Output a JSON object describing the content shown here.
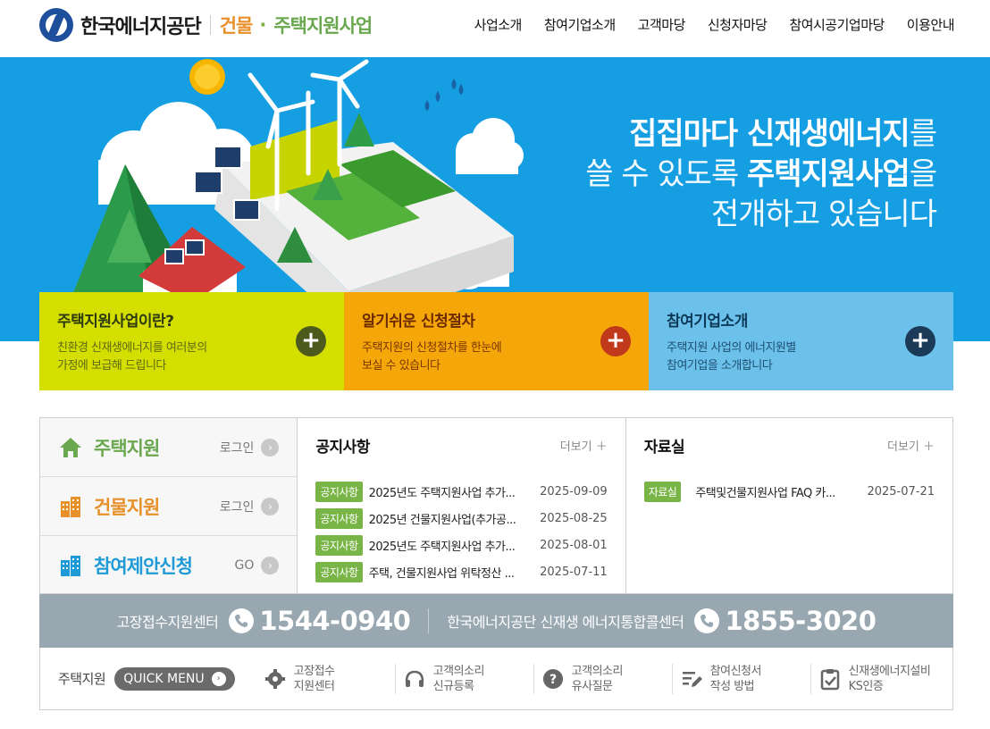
{
  "header": {
    "org_name": "한국에너지공단",
    "service_a": "건물",
    "service_dot": "·",
    "service_b": "주택지원사업",
    "nav": [
      "사업소개",
      "참여기업소개",
      "고객마당",
      "신청자마당",
      "참여시공기업마당",
      "이용안내"
    ]
  },
  "hero": {
    "line1_bold": "집집마다 신재생에너지",
    "line1_light": "를",
    "line2_light": "쓸 수 있도록 ",
    "line2_bold": "주택지원사업",
    "line2_light_end": "을",
    "line3_light": "전개하고 있습니다"
  },
  "cards": [
    {
      "title": "주택지원사업이란?",
      "desc1": "친환경 신재생에너지를 여러분의",
      "desc2": "가정에 보급해 드립니다",
      "plus": "+"
    },
    {
      "title": "알기쉬운 신청절차",
      "desc1": "주택지원의 신청절차를 한눈에",
      "desc2": "보실 수 있습니다",
      "plus": "+"
    },
    {
      "title": "참여기업소개",
      "desc1": "주택지원 사업의 에너지원별",
      "desc2": "참여기업을 소개합니다",
      "plus": "+"
    }
  ],
  "quick": [
    {
      "label": "주택지원",
      "link": "로그인",
      "color": "#6aa84f"
    },
    {
      "label": "건물지원",
      "link": "로그인",
      "color": "#e8912b"
    },
    {
      "label": "참여제안신청",
      "link": "GO",
      "color": "#1e9ad6"
    }
  ],
  "notice": {
    "title": "공지사항",
    "more": "더보기 ＋",
    "posts": [
      {
        "tag": "공지사항",
        "title": "2025년도 주택지원사업 추가...",
        "date": "2025-09-09"
      },
      {
        "tag": "공지사항",
        "title": "2025년 건물지원사업(추가공...",
        "date": "2025-08-25"
      },
      {
        "tag": "공지사항",
        "title": "2025년도 주택지원사업 추가...",
        "date": "2025-08-01"
      },
      {
        "tag": "공지사항",
        "title": "주택, 건물지원사업 위탁정산 ...",
        "date": "2025-07-11"
      }
    ]
  },
  "archive": {
    "title": "자료실",
    "more": "더보기 ＋",
    "posts": [
      {
        "tag": "자료실",
        "title": "주택및건물지원사업 FAQ 카...",
        "date": "2025-07-21"
      }
    ]
  },
  "callcenter": {
    "label1": "고장접수지원센터",
    "num1": "1544-0940",
    "label2": "한국에너지공단 신재생 에너지통합콜센터",
    "num2": "1855-3020"
  },
  "quickmenu": {
    "label": "주택지원",
    "button": "QUICK MENU",
    "arrow": "›",
    "items": [
      {
        "l1": "고장접수",
        "l2": "지원센터",
        "icon": "gear-icon"
      },
      {
        "l1": "고객의소리",
        "l2": "신규등록",
        "icon": "headset-icon"
      },
      {
        "l1": "고객의소리",
        "l2": "유사질문",
        "icon": "question-icon"
      },
      {
        "l1": "참여신청서",
        "l2": "작성 방법",
        "icon": "pencil-list-icon"
      },
      {
        "l1": "신재생에너지설비",
        "l2": "KS인증",
        "icon": "clipboard-check-icon"
      }
    ]
  }
}
